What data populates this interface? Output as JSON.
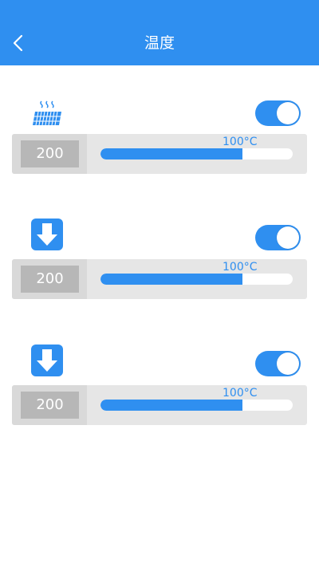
{
  "header": {
    "title": "温度",
    "background_color": "#2f8ff0",
    "back_icon": "chevron-left-icon"
  },
  "rows": [
    {
      "icon": "heater-icon",
      "toggle_on": true,
      "value": "200",
      "slider_label": "100°C",
      "slider_fill_fraction": 0.74
    },
    {
      "icon": "down-arrow-icon",
      "toggle_on": true,
      "value": "200",
      "slider_label": "100°C",
      "slider_fill_fraction": 0.74
    },
    {
      "icon": "down-arrow-icon",
      "toggle_on": true,
      "value": "200",
      "slider_label": "100°C",
      "slider_fill_fraction": 0.74
    }
  ],
  "colors": {
    "accent": "#2f8ff0",
    "panel": "#e6e6e6",
    "value_box": "#b7b7b7"
  }
}
